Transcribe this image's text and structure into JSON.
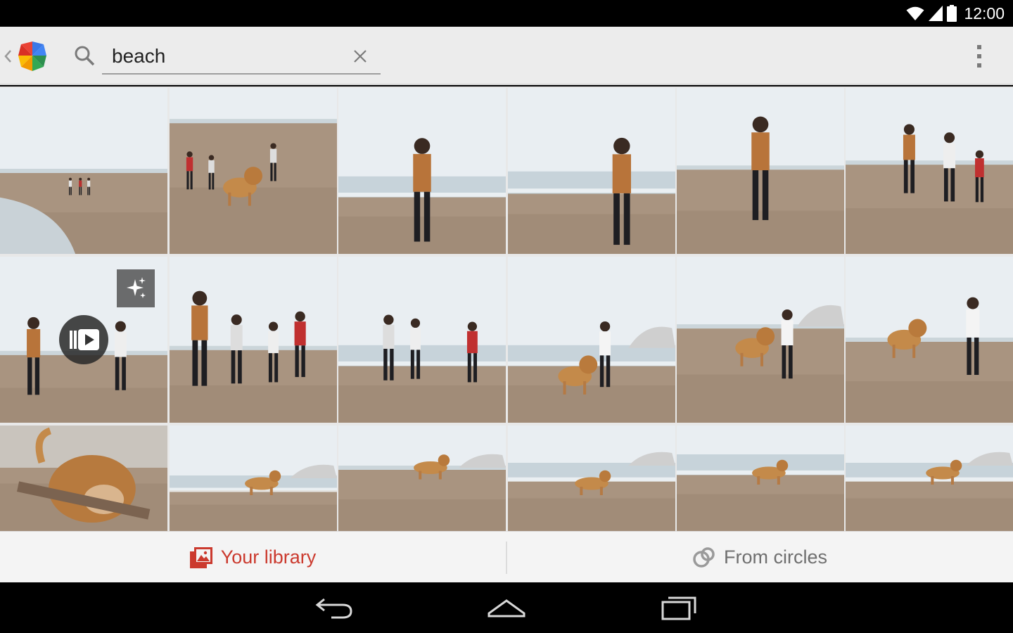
{
  "status_bar": {
    "time": "12:00",
    "icons": [
      "wifi-icon",
      "signal-icon",
      "battery-icon"
    ]
  },
  "action_bar": {
    "app_icon": "google-photos-pinwheel-icon",
    "search_icon": "search-icon",
    "search_value": "beach",
    "search_placeholder": "",
    "clear_icon": "close-icon",
    "overflow_icon": "overflow-menu-icon"
  },
  "grid": {
    "photos": [
      {
        "id": "r1c1",
        "scene": "beach-run-distant"
      },
      {
        "id": "r1c2",
        "scene": "beach-friends-dog"
      },
      {
        "id": "r1c3",
        "scene": "woman-smiling-surf"
      },
      {
        "id": "r1c4",
        "scene": "woman-looking-sea"
      },
      {
        "id": "r1c5",
        "scene": "woman-arm-raised"
      },
      {
        "id": "r1c6",
        "scene": "group-jumping"
      },
      {
        "id": "r2c1",
        "scene": "group-jumping-video"
      },
      {
        "id": "r2c2",
        "scene": "friends-running"
      },
      {
        "id": "r2c3",
        "scene": "friends-running-shore"
      },
      {
        "id": "r2c4",
        "scene": "woman-dog-sitting"
      },
      {
        "id": "r2c5",
        "scene": "dog-stick-woman"
      },
      {
        "id": "r2c6",
        "scene": "dog-stick-woman-2"
      },
      {
        "id": "r3c1",
        "scene": "dog-closeup-stick"
      },
      {
        "id": "r3c2",
        "scene": "dog-stick-surf"
      },
      {
        "id": "r3c3",
        "scene": "dog-standing"
      },
      {
        "id": "r3c4",
        "scene": "dog-lying"
      },
      {
        "id": "r3c5",
        "scene": "dog-ball"
      },
      {
        "id": "r3c6",
        "scene": "dog-ball-2"
      }
    ],
    "overlays": {
      "auto_awesome_icon": "auto-awesome-sparkle-icon",
      "video_badge_icon": "movie-play-icon"
    }
  },
  "tabs": {
    "library": {
      "label": "Your library",
      "icon": "photo-library-icon",
      "active": true
    },
    "circles": {
      "label": "From circles",
      "icon": "circles-icon",
      "active": false
    }
  },
  "nav_bar": {
    "icons": [
      "back-icon",
      "home-icon",
      "recents-icon"
    ]
  },
  "colors": {
    "accent": "#cb3a2e",
    "action_bar": "#ececec",
    "tab_inactive": "#6f6f6f"
  }
}
